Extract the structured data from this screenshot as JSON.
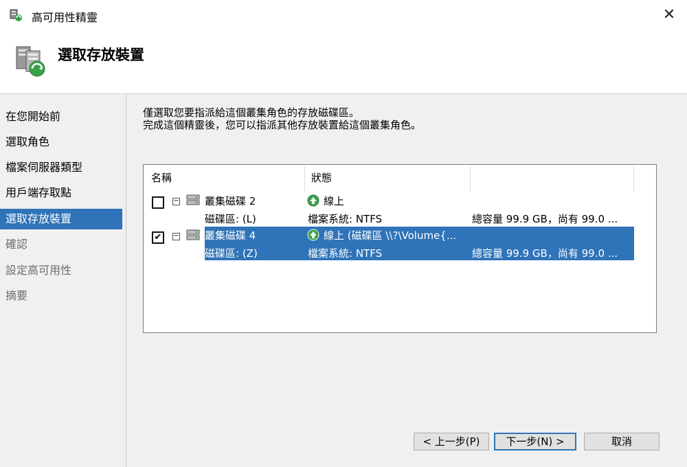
{
  "window": {
    "title": "高可用性精靈",
    "close_glyph": "✕"
  },
  "header": {
    "page_title": "選取存放裝置"
  },
  "sidebar": {
    "items": [
      {
        "label": "在您開始前",
        "state": "done"
      },
      {
        "label": "選取角色",
        "state": "done"
      },
      {
        "label": "檔案伺服器類型",
        "state": "done"
      },
      {
        "label": "用戶端存取點",
        "state": "done"
      },
      {
        "label": "選取存放裝置",
        "state": "active"
      },
      {
        "label": "確認",
        "state": "pending"
      },
      {
        "label": "設定高可用性",
        "state": "pending"
      },
      {
        "label": "摘要",
        "state": "pending"
      }
    ]
  },
  "main": {
    "instruction_line1": "僅選取您要指派給這個叢集角色的存放磁碟區。",
    "instruction_line2": "完成這個精靈後，您可以指派其他存放裝置給這個叢集角色。",
    "columns": {
      "name": "名稱",
      "status": "狀態",
      "info": ""
    },
    "disks": [
      {
        "name": "叢集磁碟 2",
        "checked": false,
        "status": "線上",
        "volume": "磁碟區: (L)",
        "filesystem": "檔案系統: NTFS",
        "capacity": "總容量 99.9 GB，尚有 99.0 ..."
      },
      {
        "name": "叢集磁碟 4",
        "checked": true,
        "status": "線上 (磁碟區 \\\\?\\Volume{...",
        "volume": "磁碟區: (Z)",
        "filesystem": "檔案系統: NTFS",
        "capacity": "總容量 99.9 GB，尚有 99.0 ..."
      }
    ],
    "check_glyph": "✔",
    "expander_glyph": "−"
  },
  "buttons": {
    "back": "< 上一步(P)",
    "next": "下一步(N) >",
    "cancel": "取消"
  },
  "colors": {
    "selection": "#2f73b8",
    "panel": "#f0f0f0",
    "online_green": "#3aa34a"
  },
  "icons": {
    "window": "server-wizard-icon",
    "header": "server-cluster-icon",
    "disk": "disk-icon",
    "status": "online-arrow-icon"
  }
}
